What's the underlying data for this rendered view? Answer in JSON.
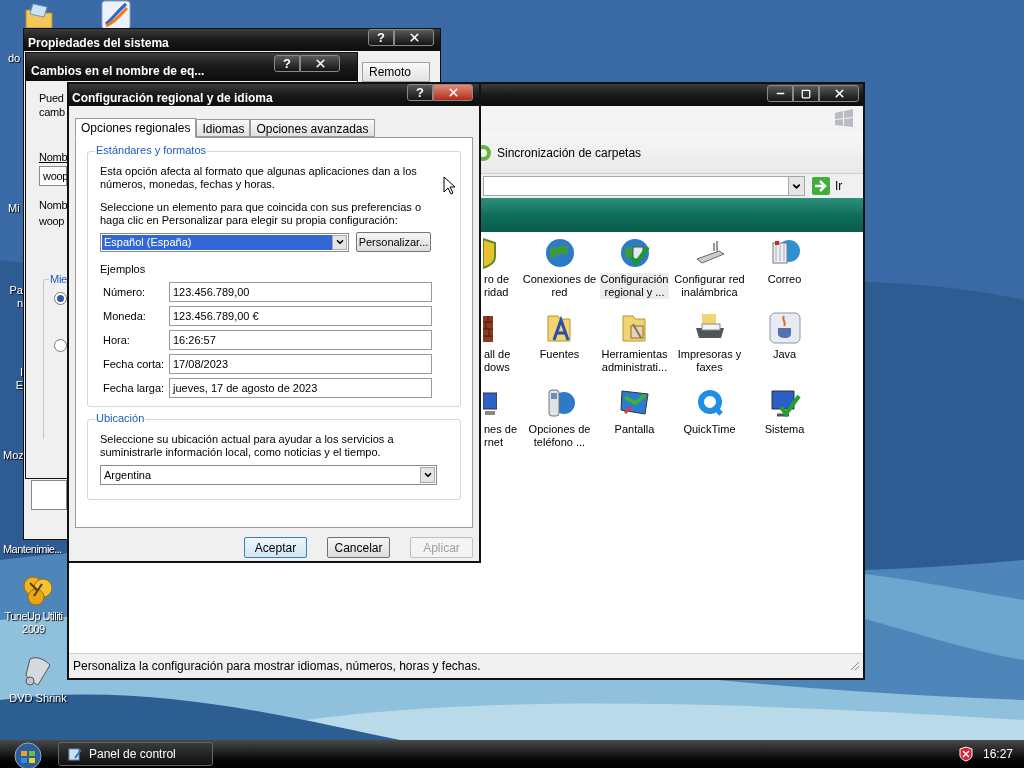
{
  "desktop": {
    "icons": [
      {
        "lines": [
          "do"
        ]
      },
      {
        "lines": [
          "Mi"
        ]
      },
      {
        "lines": [
          "Pa",
          "n"
        ]
      },
      {
        "lines": [
          "I",
          "E"
        ]
      },
      {
        "lines": [
          "Moz"
        ]
      },
      {
        "lines": [
          "Mantenimie..."
        ]
      },
      {
        "lines": [
          "TuneUp Utiliti",
          "2009"
        ]
      },
      {
        "lines": [
          "DVD Shrink"
        ]
      }
    ]
  },
  "system_properties": {
    "title": "Propiedades del sistema",
    "help_button": "?",
    "tabs": [
      {
        "label": "Remoto",
        "selected": false
      }
    ]
  },
  "computer_name_changes": {
    "title": "Cambios en el nombre de eq...",
    "help_button": "?",
    "intro_lines": [
      "Pued",
      "camb"
    ],
    "name_label_1": "Nomb",
    "name_field": "woop",
    "name_label_2": "Nomb",
    "name_value": "woop",
    "group_legend": "Mie",
    "radios": [
      {
        "selected": true
      },
      {
        "selected": false
      }
    ]
  },
  "control_panel": {
    "toolbar_item": "Sincronización de carpetas",
    "go_button": "Ir",
    "items": [
      {
        "lines": [
          "ro de",
          "ridad"
        ],
        "selected": false
      },
      {
        "lines": [
          "Conexiones de",
          "red"
        ],
        "selected": false
      },
      {
        "lines": [
          "Configuración",
          "regional y ..."
        ],
        "selected": true
      },
      {
        "lines": [
          "Configurar red",
          "inalámbrica"
        ],
        "selected": false
      },
      {
        "lines": [
          "Correo"
        ],
        "selected": false
      },
      {
        "lines": [
          "all de",
          "dows"
        ],
        "selected": false
      },
      {
        "lines": [
          "Fuentes"
        ],
        "selected": false
      },
      {
        "lines": [
          "Herramientas",
          "administrati..."
        ],
        "selected": false
      },
      {
        "lines": [
          "Impresoras y",
          "faxes"
        ],
        "selected": false
      },
      {
        "lines": [
          "Java"
        ],
        "selected": false
      },
      {
        "lines": [
          "nes de",
          "rnet"
        ],
        "selected": false
      },
      {
        "lines": [
          "Opciones de",
          "teléfono ..."
        ],
        "selected": false
      },
      {
        "lines": [
          "Pantalla"
        ],
        "selected": false
      },
      {
        "lines": [
          "QuickTime"
        ],
        "selected": false
      },
      {
        "lines": [
          "Sistema"
        ],
        "selected": false
      }
    ],
    "status_bar": "Personaliza la configuración para mostrar idiomas, números, horas y fechas."
  },
  "regional_dialog": {
    "title": "Configuración regional y de idioma",
    "help_button": "?",
    "tabs": [
      {
        "label": "Opciones regionales",
        "selected": true
      },
      {
        "label": "Idiomas",
        "selected": false
      },
      {
        "label": "Opciones avanzadas",
        "selected": false
      }
    ],
    "standards": {
      "legend": "Estándares y formatos",
      "intro": "Esta opción afecta al formato que algunas aplicaciones dan a los números, monedas, fechas y horas.",
      "prompt": "Seleccione un elemento para que coincida con sus preferencias o haga clic en Personalizar para elegir su propia configuración:",
      "format": "Español (España)",
      "customize_button": "Personalizar...",
      "examples_label": "Ejemplos",
      "examples": [
        {
          "label": "Número:",
          "value": "123.456.789,00"
        },
        {
          "label": "Moneda:",
          "value": "123.456.789,00 €"
        },
        {
          "label": "Hora:",
          "value": "16:26:57"
        },
        {
          "label": "Fecha corta:",
          "value": "17/08/2023"
        },
        {
          "label": "Fecha larga:",
          "value": "jueves, 17 de agosto de 2023"
        }
      ]
    },
    "location": {
      "legend": "Ubicación",
      "text": "Seleccione su ubicación actual para ayudar a los servicios a suministrarle información local, como noticias y el tiempo.",
      "value": "Argentina"
    },
    "buttons": [
      {
        "label": "Aceptar",
        "default": true,
        "disabled": false
      },
      {
        "label": "Cancelar",
        "default": false,
        "disabled": false
      },
      {
        "label": "Aplicar",
        "default": false,
        "disabled": true
      }
    ]
  },
  "taskbar": {
    "tasks": [
      {
        "label": "Panel de control"
      }
    ],
    "clock": "16:27"
  }
}
